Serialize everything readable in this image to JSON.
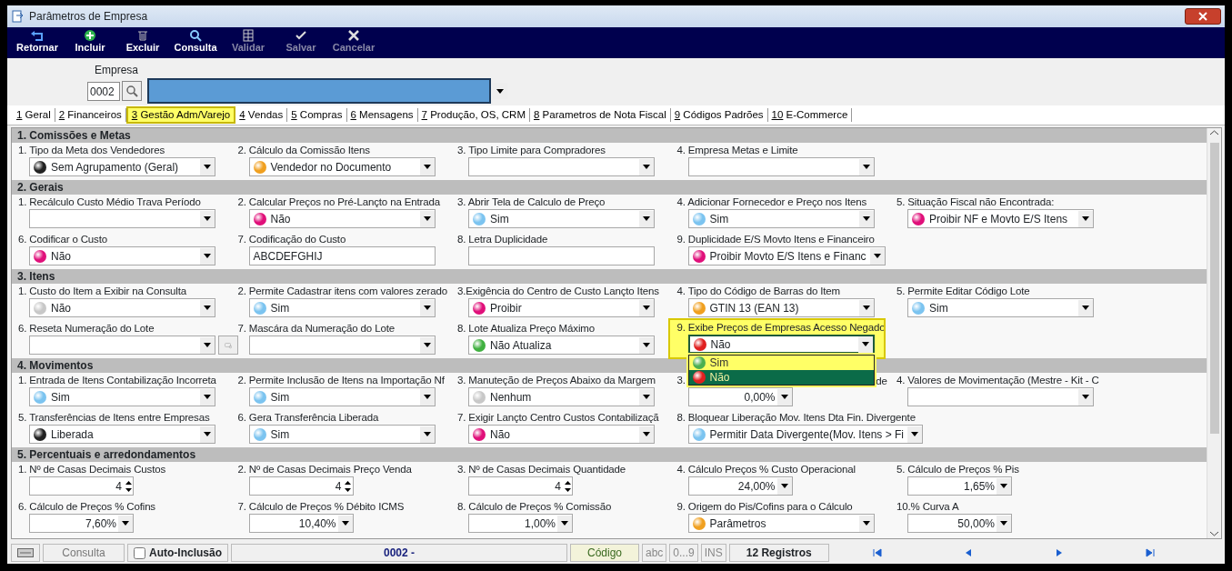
{
  "window": {
    "title": "Parâmetros de Empresa"
  },
  "toolbar": [
    {
      "label": "Retornar",
      "disabled": false
    },
    {
      "label": "Incluir",
      "disabled": false
    },
    {
      "label": "Excluir",
      "disabled": false
    },
    {
      "label": "Consulta",
      "disabled": false
    },
    {
      "label": "Validar",
      "disabled": true
    },
    {
      "label": "Salvar",
      "disabled": true
    },
    {
      "label": "Cancelar",
      "disabled": true
    }
  ],
  "empresa": {
    "label": "Empresa",
    "code": "0002"
  },
  "tabs": [
    {
      "key": "1",
      "label": "Geral",
      "selected": false
    },
    {
      "key": "2",
      "label": "Financeiros",
      "selected": false
    },
    {
      "key": "3",
      "label": "Gestão Adm/Varejo",
      "selected": true
    },
    {
      "key": "4",
      "label": "Vendas",
      "selected": false
    },
    {
      "key": "5",
      "label": "Compras",
      "selected": false
    },
    {
      "key": "6",
      "label": "Mensagens",
      "selected": false
    },
    {
      "key": "7",
      "label": "Produção, OS, CRM",
      "selected": false
    },
    {
      "key": "8",
      "label": "Parametros de Nota Fiscal",
      "selected": false
    },
    {
      "key": "9",
      "label": "Códigos Padrões",
      "selected": false
    },
    {
      "key": "10",
      "label": "E-Commerce",
      "selected": false
    }
  ],
  "sections": [
    {
      "title": "1.  Comissões e Metas",
      "rows": [
        [
          {
            "kind": "select",
            "label": "1. Tipo da Meta dos Vendedores",
            "value": "Sem Agrupamento (Geral)",
            "color": "#222222"
          },
          {
            "kind": "select",
            "label": "2. Cálculo da Comissão Itens",
            "value": "Vendedor no Documento",
            "color": "#f0a020"
          },
          {
            "kind": "select",
            "label": "3. Tipo Limite para Compradores"
          },
          {
            "kind": "select",
            "label": "4. Empresa Metas e Limite"
          }
        ]
      ]
    },
    {
      "title": "2. Gerais",
      "rows": [
        [
          {
            "kind": "select",
            "label": "1. Recálculo Custo Médio Trava Período"
          },
          {
            "kind": "select",
            "label": "2. Calcular Preços no Pré-Lançto na Entrada",
            "value": "Não",
            "color": "#e0107a"
          },
          {
            "kind": "select",
            "label": "3. Abrir Tela de Calculo de Preço",
            "value": "Sim",
            "color": "#7cc4f0"
          },
          {
            "kind": "select",
            "label": "4. Adicionar Fornecedor e Preço nos Itens",
            "value": "Sim",
            "color": "#7cc4f0"
          },
          {
            "kind": "select",
            "label": "5. Situação Fiscal não Encontrada:",
            "value": "Proibir NF e Movto E/S Itens",
            "color": "#e0107a"
          }
        ],
        [
          {
            "kind": "select",
            "label": "6. Codificar o Custo",
            "value": "Não",
            "color": "#e0107a"
          },
          {
            "kind": "text",
            "label": "7. Codificação do Custo",
            "value": "ABCDEFGHIJ"
          },
          {
            "kind": "text",
            "label": "8. Letra Duplicidade"
          },
          {
            "kind": "select",
            "label": "9. Duplicidade E/S Movto Itens e Financeiro",
            "value": "Proibir Movto E/S Itens e Financ",
            "color": "#e0107a"
          }
        ]
      ]
    },
    {
      "title": "3. Itens",
      "rows": [
        [
          {
            "kind": "select",
            "label": "1. Custo do Item a Exibir na Consulta",
            "value": "Não",
            "color": "#c8c8c8"
          },
          {
            "kind": "select",
            "label": "2. Permite Cadastrar itens com valores zerado",
            "value": "Sim",
            "color": "#7cc4f0"
          },
          {
            "kind": "select",
            "label": "3.Exigência do Centro de Custo Lançto Itens",
            "value": "Proibir",
            "color": "#e0107a"
          },
          {
            "kind": "select",
            "label": "4. Tipo do Código de Barras do Item",
            "value": "GTIN 13 (EAN 13)",
            "color": "#f0a020"
          },
          {
            "kind": "select",
            "label": "5. Permite Editar Código Lote",
            "value": "Sim",
            "color": "#7cc4f0"
          }
        ],
        [
          {
            "kind": "select",
            "label": "6. Reseta Numeração do Lote",
            "extra_button": true
          },
          {
            "kind": "select",
            "label": "7. Mascára da Numeração do Lote"
          },
          {
            "kind": "select",
            "label": "8. Lote Atualiza Preço Máximo",
            "value": "Não Atualiza",
            "color": "#40b040"
          },
          {
            "kind": "select",
            "label": "9. Exibe Preços de Empresas Acesso Negado",
            "value": "Não",
            "color": "#e02020",
            "highlighted": true,
            "open": true,
            "options": [
              {
                "label": "Sim",
                "color": "#4cb050",
                "selected": false
              },
              {
                "label": "Não",
                "color": "#e02020",
                "selected": true
              }
            ]
          }
        ]
      ]
    },
    {
      "title": "4. Movimentos",
      "rows": [
        [
          {
            "kind": "select",
            "label": "1. Entrada de Itens Contabilização Incorreta",
            "value": "Sim",
            "color": "#7cc4f0"
          },
          {
            "kind": "select",
            "label": "2. Permite Inclusão de Itens na Importação Nf",
            "value": "Sim",
            "color": "#7cc4f0"
          },
          {
            "kind": "select",
            "label": "3. Manuteção de Preços Abaixo  da Margem",
            "value": "Nenhum",
            "color": "#c8c8c8"
          },
          {
            "kind": "percent",
            "label": "3.",
            "label_tail": "de",
            "value": "0,00%"
          },
          {
            "kind": "select",
            "label": "4. Valores de Movimentação (Mestre - Kit - C"
          }
        ],
        [
          {
            "kind": "select",
            "label": "5. Transferências  de Itens entre Empresas",
            "value": "Liberada",
            "color": "#222222"
          },
          {
            "kind": "select",
            "label": "6. Gera Transferência Liberada",
            "value": "Sim",
            "color": "#7cc4f0"
          },
          {
            "kind": "select",
            "label": "7. Exigir Lançto Centro Custos Contabilizaçã",
            "value": "Não",
            "color": "#e0107a"
          },
          {
            "kind": "select",
            "label": "8. Bloquear Liberação Mov. Itens Dta Fin. Divergente",
            "value": "Permitir Data Divergente(Mov. Itens > Fi",
            "color": "#7cc4f0"
          }
        ]
      ]
    },
    {
      "title": "5. Percentuais e arredondamentos",
      "rows": [
        [
          {
            "kind": "spin",
            "label": "1. Nº de Casas Decimais Custos",
            "value": "4"
          },
          {
            "kind": "spin",
            "label": "2. Nº de Casas Decimais Preço Venda",
            "value": "4"
          },
          {
            "kind": "spin",
            "label": "3. Nº de Casas Decimais Quantidade",
            "value": "4"
          },
          {
            "kind": "percent",
            "label": "4. Cálculo Preços % Custo Operacional",
            "value": "24,00%"
          },
          {
            "kind": "percent",
            "label": "5. Cálculo de Preços % Pis",
            "value": "1,65%"
          }
        ],
        [
          {
            "kind": "percent",
            "label": "6. Cálculo de Preços % Cofins",
            "value": "7,60%"
          },
          {
            "kind": "percent",
            "label": "7. Cálculo de Preços % Débito ICMS",
            "value": "10,40%"
          },
          {
            "kind": "percent",
            "label": "8. Cálculo de Preços % Comissão",
            "value": "1,00%"
          },
          {
            "kind": "select",
            "label": "9. Origem do Pis/Cofins para o Cálculo",
            "value": "Parâmetros",
            "color": "#f0a020"
          },
          {
            "kind": "percent",
            "label": "10.% Curva A",
            "value": "50,00%"
          }
        ]
      ]
    }
  ],
  "status_bar": {
    "mode": "Consulta",
    "auto_inclusao": {
      "label": "Auto-Inclusão",
      "checked": false
    },
    "record": "0002 -",
    "sort": "Código",
    "indicators": [
      "abc",
      "0...9",
      "INS"
    ],
    "count": "12 Registros"
  }
}
